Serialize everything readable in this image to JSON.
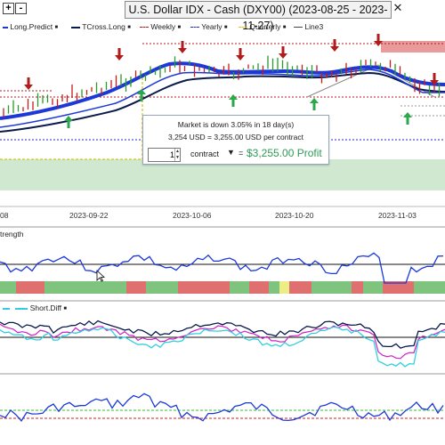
{
  "window": {
    "title": "U.S. Dollar IDX - Cash (DXY00) (2023-08-25 - 2023-11-27)",
    "buttons": [
      "+",
      "-"
    ],
    "close": "✕"
  },
  "legend": {
    "items": [
      {
        "label": "Long.Predict",
        "color": "#1c39d8"
      },
      {
        "label": "TCross.Long",
        "color": "#0b1a4a"
      },
      {
        "label": "Weekly",
        "color": "#b01c1c"
      },
      {
        "label": "Yearly",
        "color": "#2a2ab8"
      },
      {
        "label": "Quarterly",
        "color": "#d4c21a"
      },
      {
        "label": "Line3",
        "color": "#444444"
      }
    ]
  },
  "tooltip": {
    "line1": "Market is down 3.05% in 18 day(s)",
    "line2": "3,254 USD = 3,255.00 USD per contract",
    "quantity": "1",
    "contract_label": "contract",
    "caret": "▼",
    "equals": "=",
    "profit": "$3,255.00 Profit"
  },
  "x_axis": {
    "dates": [
      "08",
      "2023-09-22",
      "2023-10-06",
      "2023-10-20",
      "2023-11-03"
    ]
  },
  "panels": {
    "strength_label": "trength",
    "shortdiff_label": "Short.Diff"
  },
  "colors": {
    "green_band": "#cfe8cf",
    "strength_green": "#7ec47e",
    "strength_red": "#e0706f",
    "strength_yellow": "#eded88",
    "panel_bg": "#ffffff",
    "magenta": "#d020c8",
    "cyan": "#30cfe0",
    "navy": "#0b1a4a",
    "blue": "#1c39d8"
  },
  "icons": {
    "cursor": "mouse-pointer-icon",
    "down_arrow": "down-arrow-marker-icon",
    "up_arrow": "up-arrow-marker-icon"
  }
}
